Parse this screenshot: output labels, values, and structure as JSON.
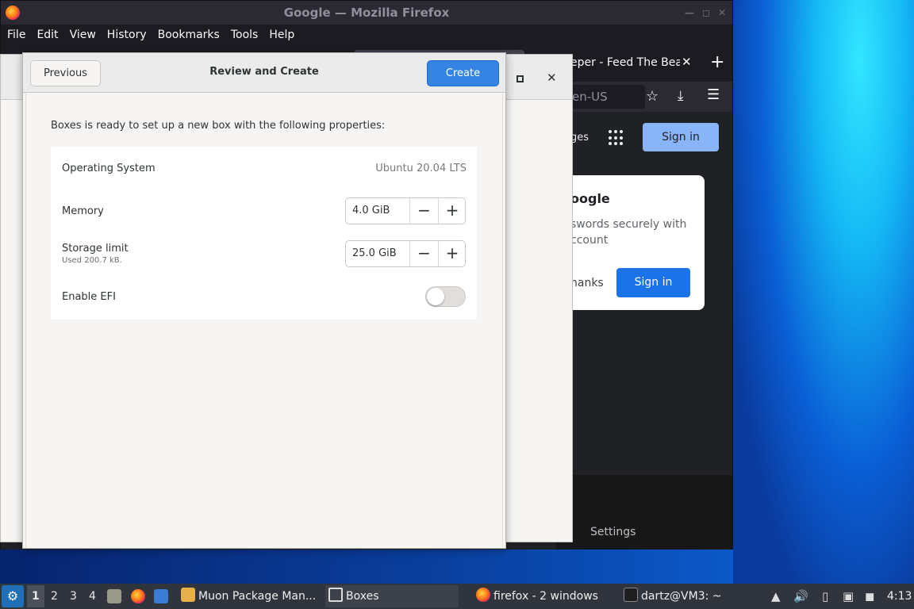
{
  "firefox": {
    "title": "Google — Mozilla Firefox",
    "menu": [
      "File",
      "Edit",
      "View",
      "History",
      "Bookmarks",
      "Tools",
      "Help"
    ],
    "tab_feed_label": "eper - Feed The Beas",
    "url_fragment": "en-US",
    "google": {
      "images_link": "ges",
      "signin_top": "Sign in",
      "card_title": "oogle",
      "card_text": "swords securely with ccount",
      "card_no": "hanks",
      "card_signin": "Sign in",
      "settings": "Settings"
    }
  },
  "dialog": {
    "title": "Review and Create",
    "previous_label": "Previous",
    "create_label": "Create",
    "intro": "Boxes is ready to set up a new box with the following properties:",
    "properties": {
      "os_label": "Operating System",
      "os_value": "Ubuntu 20.04 LTS",
      "memory_label": "Memory",
      "memory_value": "4.0 GiB",
      "storage_label": "Storage limit",
      "storage_sub": "Used 200.7 kB.",
      "storage_value": "25.0 GiB",
      "efi_label": "Enable EFI",
      "efi_enabled": false
    }
  },
  "taskbar": {
    "workspaces": [
      "1",
      "2",
      "3",
      "4"
    ],
    "items": {
      "muon": "Muon Package Man...",
      "boxes": "Boxes",
      "firefox": "firefox - 2 windows",
      "terminal": "dartz@VM3: ~"
    },
    "clock": "4:13"
  },
  "colors": {
    "accent": "#3584e4",
    "google_blue": "#1a73e8",
    "firefox_dark": "#1c1b22",
    "taskbar": "#30343c"
  }
}
